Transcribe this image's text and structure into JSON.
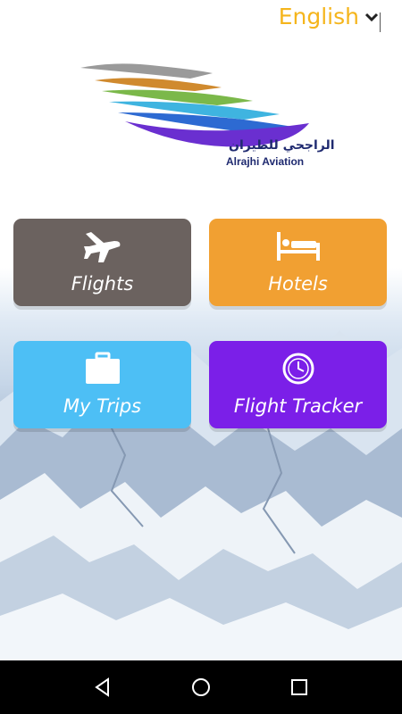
{
  "header": {
    "language": "English"
  },
  "brand": {
    "name_ar": "الراجحي للطيران",
    "name_en": "Alrajhi Aviation"
  },
  "tiles": [
    {
      "label": "Flights",
      "icon": "airplane-icon",
      "color": "#6b625f"
    },
    {
      "label": "Hotels",
      "icon": "bed-icon",
      "color": "#f1a032"
    },
    {
      "label": "My Trips",
      "icon": "briefcase-icon",
      "color": "#4dbff5"
    },
    {
      "label": "Flight Tracker",
      "icon": "clock-tracker-icon",
      "color": "#7b1fe8"
    }
  ],
  "colors": {
    "accent": "#f5b51c",
    "brand_blue": "#1f2a70"
  },
  "navbar": {
    "icons": [
      "back-icon",
      "home-icon",
      "recents-icon"
    ]
  }
}
